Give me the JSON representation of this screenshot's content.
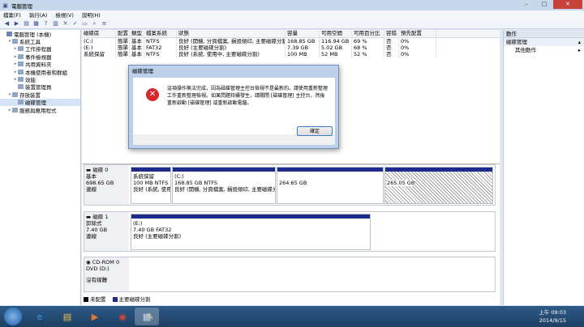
{
  "window": {
    "title": "電腦管理"
  },
  "menu": [
    "檔案(F)",
    "執行(A)",
    "檢視(V)",
    "說明(H)"
  ],
  "tree": [
    {
      "label": "電腦管理 (本機)",
      "depth": 0,
      "arrow": ""
    },
    {
      "label": "系統工具",
      "depth": 1,
      "arrow": "▾"
    },
    {
      "label": "工作排程器",
      "depth": 2,
      "arrow": "▸"
    },
    {
      "label": "事件檢視器",
      "depth": 2,
      "arrow": "▸"
    },
    {
      "label": "共用資料夾",
      "depth": 2,
      "arrow": "▸"
    },
    {
      "label": "本機使用者和群組",
      "depth": 2,
      "arrow": "▸"
    },
    {
      "label": "效能",
      "depth": 2,
      "arrow": "▸"
    },
    {
      "label": "裝置管理員",
      "depth": 2,
      "arrow": ""
    },
    {
      "label": "存放裝置",
      "depth": 1,
      "arrow": "▾"
    },
    {
      "label": "磁碟管理",
      "depth": 2,
      "arrow": "",
      "selected": true
    },
    {
      "label": "服務與應用程式",
      "depth": 1,
      "arrow": "▸"
    }
  ],
  "volumes": {
    "headers": [
      "磁碟區",
      "配置",
      "類型",
      "檔案系統",
      "狀態",
      "容量",
      "可用空間",
      "可用百分比",
      "容錯",
      "預先配置"
    ],
    "rows": [
      [
        "(C:)",
        "簡單",
        "基本",
        "NTFS",
        "良好 (開機, 分頁檔案, 損毀傾印, 主要磁碟分割)",
        "168.85 GB",
        "116.94 GB",
        "69 %",
        "否",
        "0%"
      ],
      [
        "(E:)",
        "簡單",
        "基本",
        "FAT32",
        "良好 (主要磁碟分割)",
        "7.39 GB",
        "5.02 GB",
        "68 %",
        "否",
        "0%"
      ],
      [
        "系統保留",
        "簡單",
        "基本",
        "NTFS",
        "良好 (系統, 使用中, 主要磁碟分割)",
        "100 MB",
        "52 MB",
        "52 %",
        "否",
        "0%"
      ]
    ]
  },
  "disks": [
    {
      "name": "磁碟 0",
      "type": "基本",
      "size": "698.65 GB",
      "status": "連線",
      "parts": [
        {
          "name": "系統保留",
          "size": "100 MB NTFS",
          "status": "良好 (系統, 使用"
        },
        {
          "name": "(C:)",
          "size": "168.85 GB NTFS",
          "status": "良好 (開機, 分頁檔案, 損毀傾印, 主要磁碟分"
        },
        {
          "name": "",
          "size": "264.65 GB",
          "status": ""
        },
        {
          "name": "",
          "size": "265.05 GB",
          "status": ""
        }
      ]
    },
    {
      "name": "磁碟 1",
      "type": "卸除式",
      "size": "7.40 GB",
      "status": "連線",
      "parts": [
        {
          "name": "(E:)",
          "size": "7.40 GB FAT32",
          "status": "良好 (主要磁碟分割)"
        }
      ]
    },
    {
      "name": "CD-ROM 0",
      "type": "DVD (D:)",
      "size": "",
      "status": "沒有媒體",
      "parts": []
    }
  ],
  "legend": [
    {
      "label": "未配置",
      "color": "#000000"
    },
    {
      "label": "主要磁碟分割",
      "color": "#1d2b8c"
    }
  ],
  "actions": {
    "header": "動作",
    "section": "磁碟管理",
    "item": "其他動作"
  },
  "dialog": {
    "title": "磁碟管理",
    "message": "這項操作無法完成，因為磁碟管理主控台檢視不是最新的。請使用重新整理工作重新整理檢視。如果問題持續發生，請關閉 [磁碟管理] 主控台，然後重新啟動 [磁碟管理] 或重新啟動電腦。",
    "ok": "確定"
  },
  "taskbar": {
    "time": "上午 09:03",
    "date": "2014/9/15"
  },
  "colors": {
    "primary_partition": "#1d2b8c",
    "error": "#d7282f"
  }
}
